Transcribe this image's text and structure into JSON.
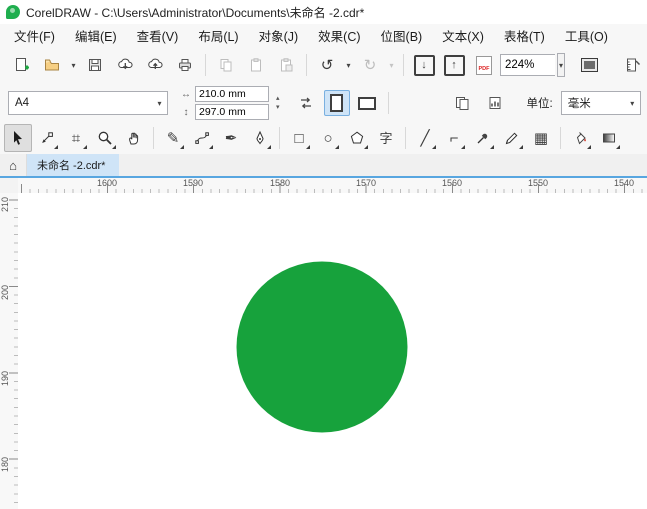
{
  "title_bar": {
    "title": "CorelDRAW - C:\\Users\\Administrator\\Documents\\未命名 -2.cdr*"
  },
  "menu": {
    "items": [
      "文件(F)",
      "编辑(E)",
      "查看(V)",
      "布局(L)",
      "对象(J)",
      "效果(C)",
      "位图(B)",
      "文本(X)",
      "表格(T)",
      "工具(O)"
    ]
  },
  "toolbar": {
    "zoom_value": "224%",
    "pdf_label": "PDF"
  },
  "property_bar": {
    "page_preset": "A4",
    "width_value": "210.0 mm",
    "height_value": "297.0 mm",
    "units_label": "单位:",
    "units_value": "毫米"
  },
  "tabs": {
    "active": "未命名 -2.cdr*"
  },
  "rulers": {
    "horizontal": [
      "1600",
      "1590",
      "1580",
      "1570",
      "1560",
      "1550",
      "1540"
    ],
    "vertical": [
      "210",
      "200",
      "190",
      "180"
    ]
  },
  "canvas": {
    "shape": "circle",
    "circle_fill": "#17A23C"
  },
  "colors": {
    "accent_blue": "#58a6e0",
    "tab_active_bg": "#cfe4f7",
    "logo_green": "#1fae4e"
  },
  "icons": {
    "caret_down": "▾",
    "arrow_down": "↓",
    "arrow_up": "↑",
    "undo": "↺",
    "redo": "↻",
    "home": "⌂",
    "crop": "⌗",
    "pencil": "✎",
    "brush_pen": "✒",
    "rectangle": "□",
    "ellipse": "○",
    "text_tool": "字",
    "line": "╱",
    "connector": "⌐",
    "checker": "▦",
    "width_arrow": "↔",
    "height_arrow": "↕",
    "spin_up": "▴",
    "spin_down": "▾"
  }
}
